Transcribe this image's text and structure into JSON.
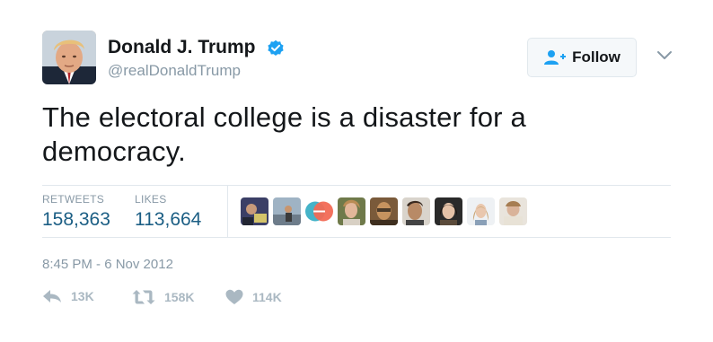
{
  "author": {
    "name": "Donald J. Trump",
    "handle": "@realDonaldTrump",
    "avatar": "portrait-avatar",
    "verified_icon": "verified-badge-icon"
  },
  "follow_button": {
    "label": "Follow",
    "icon": "add-user-icon"
  },
  "menu_icon": "chevron-down-icon",
  "tweet": {
    "text": "The electoral college is a disaster for a democracy."
  },
  "stats": {
    "retweets_label": "RETWEETS",
    "retweets_value": "158,363",
    "likes_label": "LIKES",
    "likes_value": "113,664"
  },
  "likers_count_shown": 9,
  "timestamp": "8:45 PM - 6 Nov 2012",
  "actions": {
    "reply_count": "13K",
    "retweet_count": "158K",
    "like_count": "114K"
  },
  "colors": {
    "accent_blue": "#1da1f2",
    "stat_value": "#1b5e84",
    "muted": "#8899a6",
    "action_gray": "#aab8c2"
  }
}
